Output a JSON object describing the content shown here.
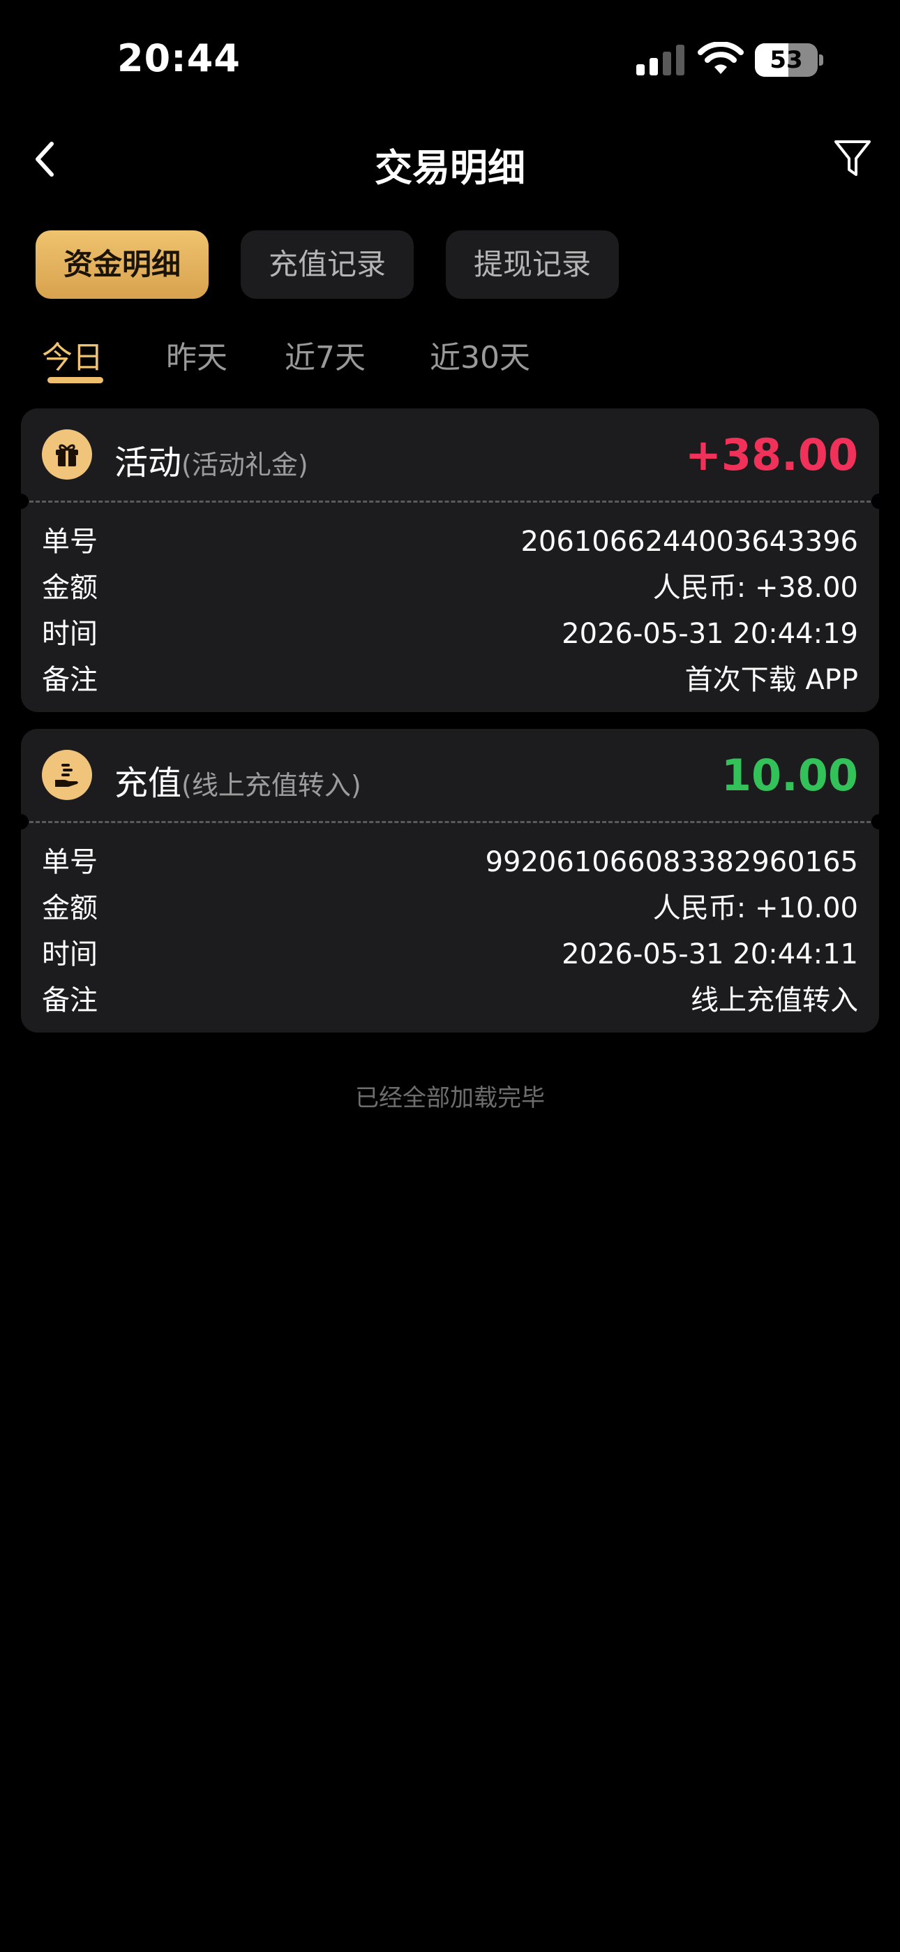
{
  "status_bar": {
    "time": "20:44",
    "battery": "53",
    "battery_level": 0.53,
    "signal_icon": "cellular-signal-icon",
    "wifi_icon": "wifi-icon"
  },
  "nav": {
    "title": "交易明细",
    "back_icon": "chevron-left-icon",
    "filter_icon": "filter-icon"
  },
  "category_tabs": [
    {
      "label": "资金明细",
      "active": true
    },
    {
      "label": "充值记录",
      "active": false
    },
    {
      "label": "提现记录",
      "active": false
    }
  ],
  "date_tabs": [
    {
      "label": "今日",
      "active": true
    },
    {
      "label": "昨天",
      "active": false
    },
    {
      "label": "近7天",
      "active": false
    },
    {
      "label": "近30天",
      "active": false
    }
  ],
  "transactions": [
    {
      "icon": "gift-icon",
      "title": "活动",
      "subtitle": "(活动礼金)",
      "amount": "+38.00",
      "amount_color": "#f0325a",
      "rows": [
        {
          "label": "单号",
          "value": "2061066244003643396"
        },
        {
          "label": "金额",
          "value": "人民币: +38.00"
        },
        {
          "label": "时间",
          "value": "2026-05-31 20:44:19"
        },
        {
          "label": "备注",
          "value": "首次下载 APP"
        }
      ]
    },
    {
      "icon": "deposit-hand-icon",
      "title": "充值",
      "subtitle": "(线上充值转入)",
      "amount": "10.00",
      "amount_color": "#33c15a",
      "rows": [
        {
          "label": "单号",
          "value": "99206106608338296016​5"
        },
        {
          "label": "金额",
          "value": "人民币: +10.00"
        },
        {
          "label": "时间",
          "value": "2026-05-31 20:44:11"
        },
        {
          "label": "备注",
          "value": "线上充值转入"
        }
      ]
    }
  ],
  "footer": {
    "end_text": "已经全部加载完毕"
  },
  "colors": {
    "accent_gold": "#eec06e",
    "card_bg": "#1c1c1e",
    "positive_red": "#f0325a",
    "positive_green": "#33c15a"
  }
}
